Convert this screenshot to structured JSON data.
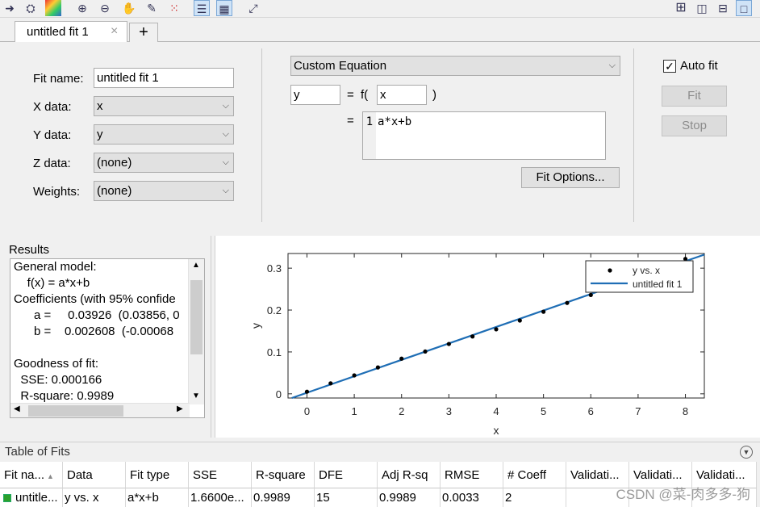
{
  "toolbar": {
    "icons": [
      "import-icon",
      "data-cursor-icon",
      "colormap-icon",
      "zoom-in-icon",
      "zoom-out-icon",
      "pan-icon",
      "data-cursor-icon-2",
      "exclude-icon",
      "legend-toggle-icon",
      "grid-toggle-icon",
      "axes-limits-icon"
    ],
    "layout_icons": [
      "layout-grid-icon",
      "layout-columns-icon",
      "layout-rows-icon",
      "layout-single-icon"
    ]
  },
  "tabs": [
    {
      "label": "untitled fit 1",
      "close": "×"
    }
  ],
  "add_tab": "+",
  "fit_setup": {
    "fit_name_label": "Fit name:",
    "fit_name_value": "untitled fit 1",
    "x_label": "X data:",
    "x_value": "x",
    "y_label": "Y data:",
    "y_value": "y",
    "z_label": "Z data:",
    "z_value": "(none)",
    "weights_label": "Weights:",
    "weights_value": "(none)"
  },
  "equation": {
    "type": "Custom Equation",
    "dep_var": "y",
    "equals": "=",
    "f_open": "f(",
    "indep_var": "x",
    "f_close": ")",
    "equals2": "=",
    "line_number": "1",
    "expression": "a*x+b",
    "fit_options": "Fit Options..."
  },
  "controls": {
    "auto_fit_label": "Auto fit",
    "auto_fit_checked": true,
    "fit_button": "Fit",
    "stop_button": "Stop"
  },
  "results": {
    "title": "Results",
    "lines": [
      "General model:",
      "    f(x) = a*x+b",
      "Coefficients (with 95% confide",
      "      a =     0.03926  (0.03856, 0",
      "      b =    0.002608  (-0.00068",
      "",
      "Goodness of fit:",
      "  SSE: 0.000166",
      "  R-square: 0.9989"
    ]
  },
  "chart_data": {
    "type": "scatter",
    "xlabel": "x",
    "ylabel": "y",
    "xlim": [
      -0.4,
      8.4
    ],
    "ylim": [
      -0.01,
      0.335
    ],
    "xticks": [
      "0",
      "1",
      "2",
      "3",
      "4",
      "5",
      "6",
      "7",
      "8"
    ],
    "yticks": [
      "0",
      "0.1",
      "0.2",
      "0.3"
    ],
    "series": [
      {
        "name": "y vs. x",
        "kind": "points",
        "color": "#000000",
        "x": [
          0,
          0.5,
          1,
          1.5,
          2,
          2.5,
          3,
          3.5,
          4,
          4.5,
          5,
          5.5,
          6,
          6.5,
          7,
          7.5,
          8
        ],
        "y": [
          0.005,
          0.025,
          0.044,
          0.063,
          0.084,
          0.101,
          0.119,
          0.137,
          0.154,
          0.175,
          0.196,
          0.217,
          0.236,
          0.256,
          0.276,
          0.296,
          0.322
        ]
      },
      {
        "name": "untitled fit 1",
        "kind": "line",
        "color": "#1f6eb5",
        "a": 0.03926,
        "b": 0.002608
      }
    ],
    "legend": "top-right",
    "grid": false
  },
  "table_of_fits": {
    "title": "Table of Fits",
    "columns": [
      "Fit na...",
      "Data",
      "Fit type",
      "SSE",
      "R-square",
      "DFE",
      "Adj R-sq",
      "RMSE",
      "# Coeff",
      "Validati...",
      "Validati...",
      "Validati..."
    ],
    "row": [
      "untitle...",
      "y vs. x",
      "a*x+b",
      "1.6600e...",
      "0.9989",
      "15",
      "0.9989",
      "0.0033",
      "2",
      "",
      "",
      ""
    ],
    "status_color": "#2ca02c"
  },
  "watermark": "CSDN @菜-肉多多-狗"
}
